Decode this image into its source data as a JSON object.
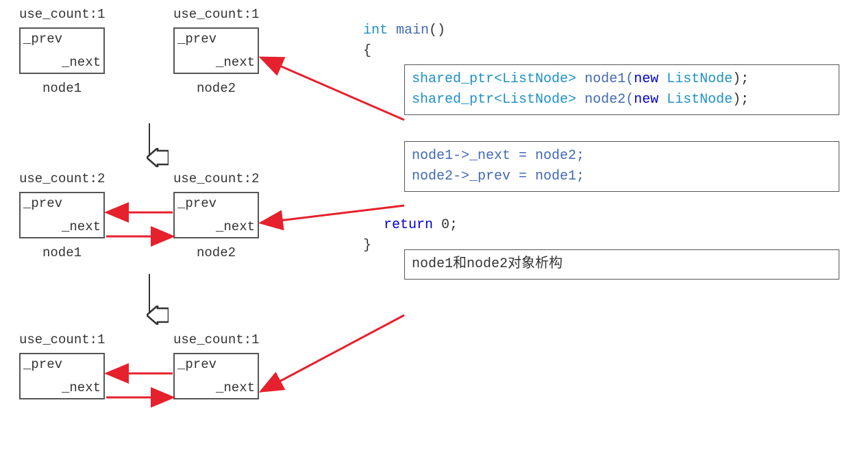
{
  "stage1": {
    "node1": {
      "use_count": "use_count:1",
      "prev": "_prev",
      "next": "_next",
      "label": "node1"
    },
    "node2": {
      "use_count": "use_count:1",
      "prev": "_prev",
      "next": "_next",
      "label": "node2"
    }
  },
  "stage2": {
    "node1": {
      "use_count": "use_count:2",
      "prev": "_prev",
      "next": "_next",
      "label": "node1"
    },
    "node2": {
      "use_count": "use_count:2",
      "prev": "_prev",
      "next": "_next",
      "label": "node2"
    }
  },
  "stage3": {
    "node1": {
      "use_count": "use_count:1",
      "prev": "_prev",
      "next": "_next"
    },
    "node2": {
      "use_count": "use_count:1",
      "prev": "_prev",
      "next": "_next"
    }
  },
  "code": {
    "main_sig_int": "int",
    "main_sig_main": " main",
    "main_sig_paren": "()",
    "brace_open": "{",
    "line1_shared": "shared_ptr",
    "line1_tpl": "<ListNode>",
    "line1_var": " node1(",
    "line1_new": "new",
    "line1_type": " ListNode",
    "line1_end": ");",
    "line2_shared": "shared_ptr",
    "line2_tpl": "<ListNode>",
    "line2_var": " node2(",
    "line2_new": "new",
    "line2_type": " ListNode",
    "line2_end": ");",
    "assign1": "node1->_next = node2;",
    "assign2": "node2->_prev = node1;",
    "return_kw": "return",
    "return_val": " 0;",
    "brace_close": "}",
    "destruct": "node1和node2对象析构"
  }
}
